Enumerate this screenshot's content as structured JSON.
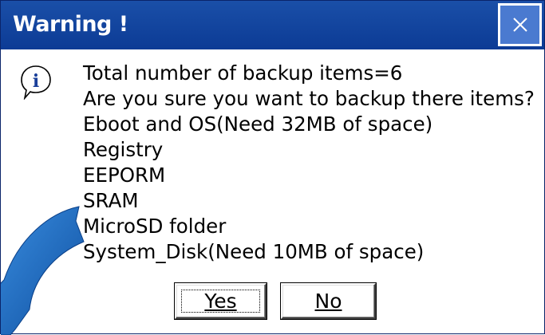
{
  "dialog": {
    "title": "Warning !",
    "close_icon": "close-icon",
    "info_icon": "information-icon",
    "messages": [
      "Total number of backup items=6",
      "Are you sure you want to backup there items?",
      "Eboot and OS(Need 32MB of space)",
      "Registry",
      "EEPORM",
      "SRAM",
      "MicroSD folder",
      "System_Disk(Need 10MB of space)"
    ],
    "buttons": {
      "yes_label": "Yes",
      "no_label": "No"
    }
  },
  "colors": {
    "titlebar": "#0c3b95",
    "arrow": "#1e74c8",
    "text": "#000000"
  }
}
